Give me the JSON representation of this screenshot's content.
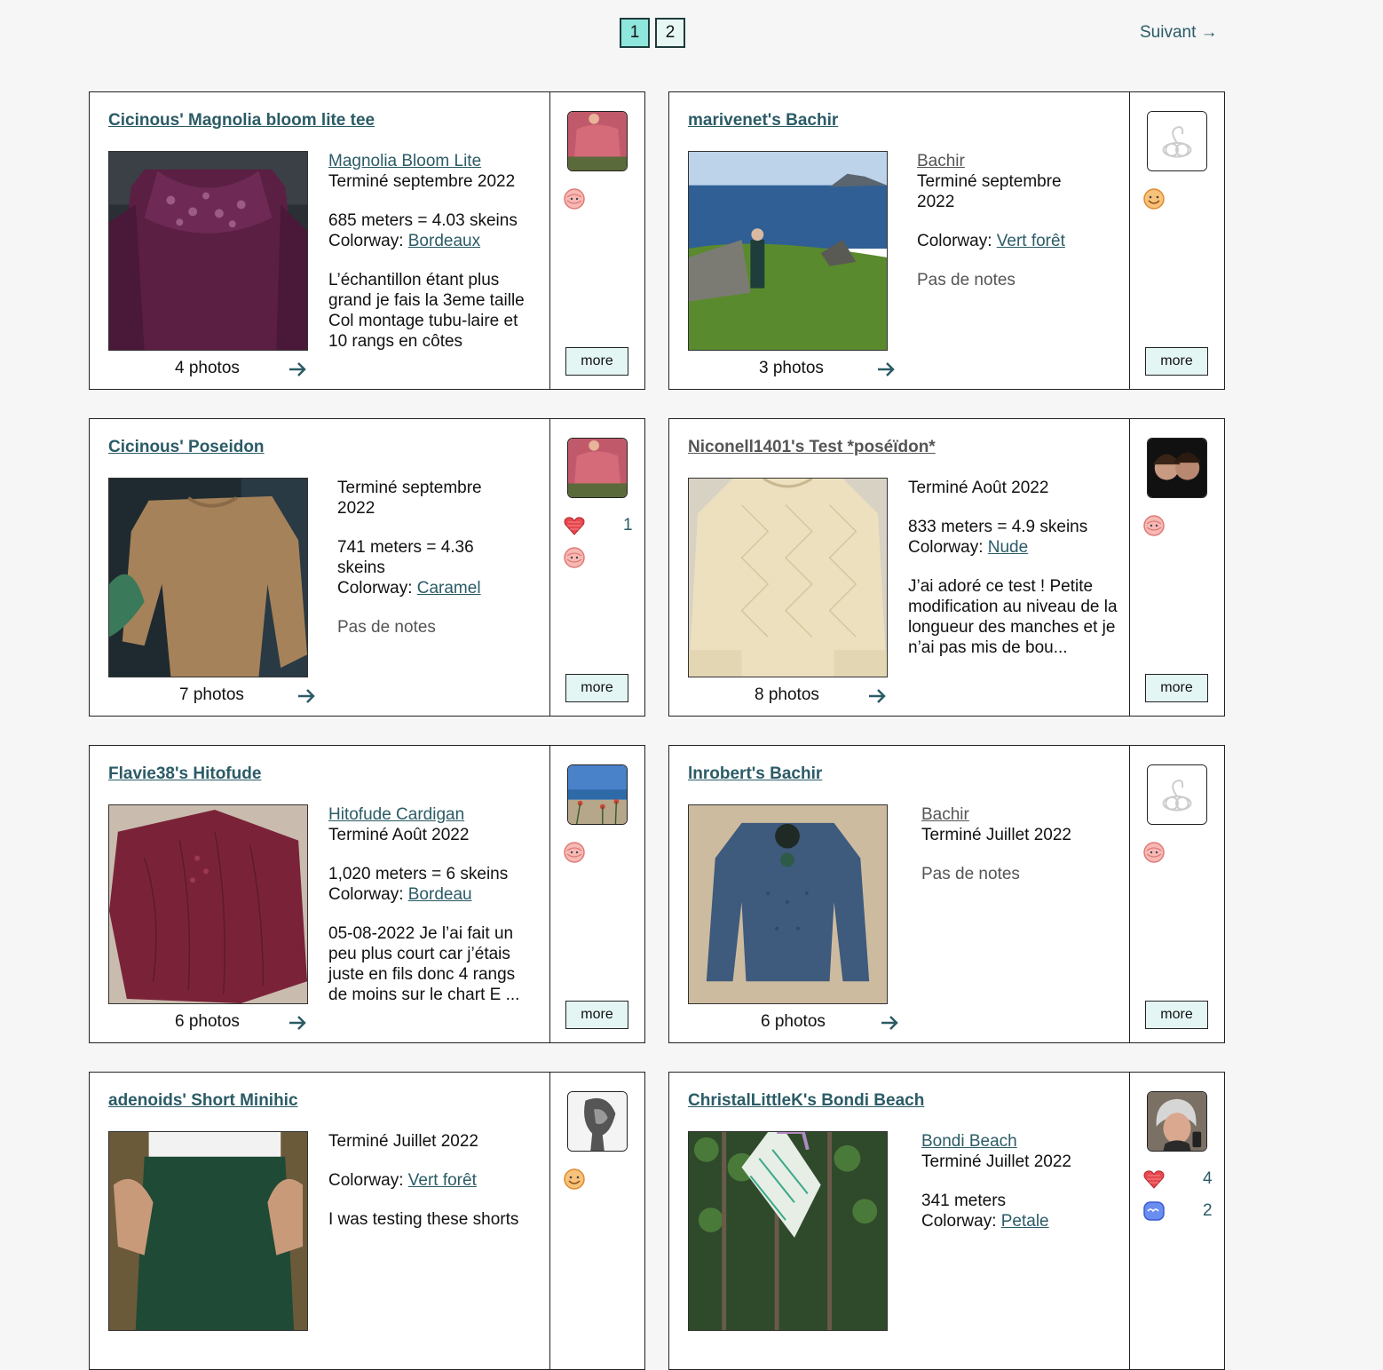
{
  "pagination": {
    "pages": [
      "1",
      "2"
    ],
    "next_label": "Suivant →"
  },
  "cards": [
    {
      "title": "Cicinous' Magnolia bloom lite tee",
      "pattern": "Magnolia Bloom Lite",
      "status": "Terminé septembre 2022",
      "meters": "685 meters = 4.03 skeins",
      "colorway_label": "Colorway: ",
      "colorway": "Bordeaux",
      "notes": "L’échantillon étant plus grand je fais la 3eme taille Col montage tubu-laire et 10 rangs en côtes",
      "photos": "4 photos",
      "more": "more",
      "reactions": []
    },
    {
      "title": "marivenet's Bachir",
      "pattern": "Bachir",
      "status": "Terminé septembre 2022",
      "colorway_label": "Colorway: ",
      "colorway": "Vert forêt",
      "notes": "Pas de notes",
      "photos": "3 photos",
      "more": "more",
      "reactions": []
    },
    {
      "title": "Cicinous' Poseidon",
      "status": "Terminé septembre 2022",
      "meters": "741 meters = 4.36 skeins",
      "colorway_label": "Colorway: ",
      "colorway": "Caramel",
      "notes": "Pas de notes",
      "photos": "7 photos",
      "more": "more",
      "reactions": [
        "1"
      ]
    },
    {
      "title": "Niconell1401's Test *poséïdon*",
      "status": "Terminé Août 2022",
      "meters": "833 meters = 4.9 skeins",
      "colorway_label": "Colorway: ",
      "colorway": "Nude",
      "notes": "J’ai adoré ce test ! Petite modification au niveau de la longueur des manches et je n’ai pas mis de bou...",
      "photos": "8 photos",
      "more": "more",
      "reactions": []
    },
    {
      "title": "Flavie38's Hitofude",
      "pattern": "Hitofude Cardigan",
      "status": "Terminé Août 2022",
      "meters": "1,020 meters = 6 skeins",
      "colorway_label": "Colorway: ",
      "colorway": "Bordeau",
      "notes": "05-08-2022 Je l’ai fait un peu plus court car j’étais juste en fils donc 4 rangs de moins sur le chart E ...",
      "photos": "6 photos",
      "more": "more",
      "reactions": []
    },
    {
      "title": "lnrobert's Bachir",
      "pattern": "Bachir",
      "status": "Terminé Juillet 2022",
      "notes": "Pas de notes",
      "photos": "6 photos",
      "more": "more",
      "reactions": []
    },
    {
      "title": "adenoids' Short Minihic",
      "status": "Terminé Juillet 2022",
      "colorway_label": "Colorway: ",
      "colorway": "Vert forêt",
      "notes": "I was testing these shorts",
      "more": "more",
      "reactions": []
    },
    {
      "title": "ChristalLittleK's Bondi Beach",
      "pattern": "Bondi Beach",
      "status": "Terminé Juillet 2022",
      "meters": "341 meters",
      "colorway_label": "Colorway: ",
      "colorway": "Petale",
      "more": "more",
      "reactions": [
        "4",
        "2"
      ]
    }
  ],
  "colors": {
    "accent_teal": "#2b5b66",
    "active_page": "#8ee6dc",
    "button_bg": "#e4f6f3",
    "border": "#222222"
  }
}
